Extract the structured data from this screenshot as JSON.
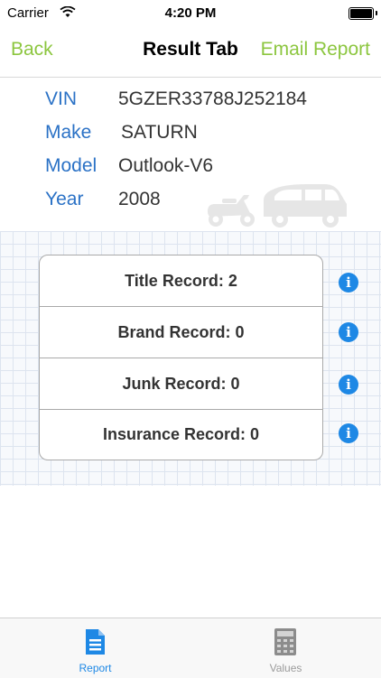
{
  "status_bar": {
    "carrier": "Carrier",
    "time": "4:20 PM"
  },
  "nav": {
    "back_label": "Back",
    "title": "Result Tab",
    "email_label": "Email Report"
  },
  "vehicle": [
    {
      "label": "VIN",
      "value": "5GZER33788J252184"
    },
    {
      "label": "Make",
      "value": "SATURN"
    },
    {
      "label": "Model",
      "value": "Outlook-V6"
    },
    {
      "label": "Year",
      "value": "2008"
    }
  ],
  "records": [
    {
      "label": "Title Record: 2"
    },
    {
      "label": "Brand Record: 0"
    },
    {
      "label": "Junk Record: 0"
    },
    {
      "label": "Insurance Record: 0"
    }
  ],
  "tabs": [
    {
      "label": "Report",
      "selected": true,
      "icon": "document-icon"
    },
    {
      "label": "Values",
      "selected": false,
      "icon": "calculator-icon"
    }
  ],
  "colors": {
    "accent_green": "#8cc63f",
    "label_blue": "#2b72c6",
    "tab_selected": "#1e88e5",
    "tab_unselected": "#9b9b9b"
  }
}
